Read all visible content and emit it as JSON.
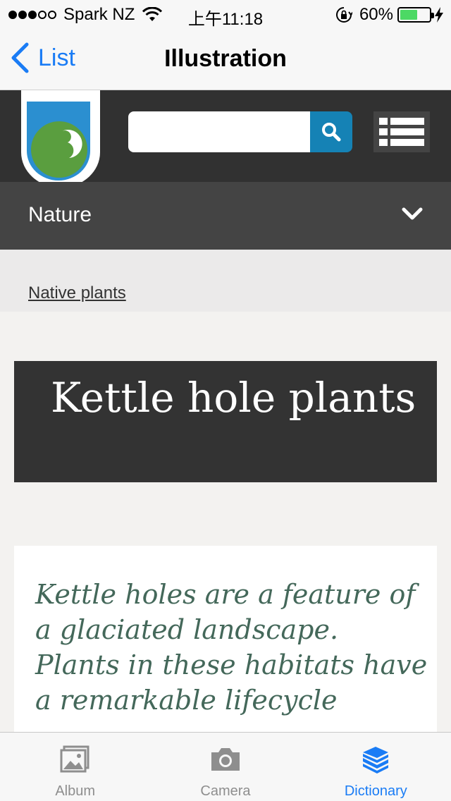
{
  "status_bar": {
    "carrier": "Spark NZ",
    "time": "上午11:18",
    "battery_percent": "60%",
    "battery_level": 0.6
  },
  "nav": {
    "back_label": "List",
    "title": "Illustration"
  },
  "header": {
    "search_value": "",
    "icons": [
      "logo-icon",
      "search-icon",
      "menu-icon"
    ],
    "search_button_color": "#1582b5"
  },
  "section": {
    "label": "Nature"
  },
  "breadcrumb": {
    "label": "Native plants"
  },
  "article": {
    "title": "Kettle hole plants",
    "intro": "Kettle holes are a feature of a glaciated landscape. Plants in these habitats have a remarkable lifecycle"
  },
  "tabs": [
    {
      "label": "Album",
      "icon": "album-icon",
      "active": false
    },
    {
      "label": "Camera",
      "icon": "camera-icon",
      "active": false
    },
    {
      "label": "Dictionary",
      "icon": "dictionary-icon",
      "active": true
    }
  ],
  "colors": {
    "accent": "#1a7cf5",
    "header_bg": "#313131",
    "intro_text": "#44685a"
  }
}
